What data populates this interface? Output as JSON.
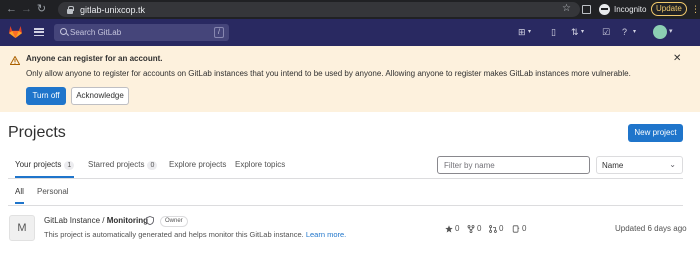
{
  "browser": {
    "url": "gitlab-unixcop.tk",
    "incognito_label": "Incognito",
    "update_label": "Update"
  },
  "search": {
    "placeholder": "Search GitLab",
    "shortcut": "/"
  },
  "alert": {
    "title": "Anyone can register for an account.",
    "message": "Only allow anyone to register for accounts on GitLab instances that you intend to be used by anyone. Allowing anyone to register makes GitLab instances more vulnerable.",
    "primary_button": "Turn off",
    "secondary_button": "Acknowledge"
  },
  "page": {
    "title": "Projects",
    "new_project_button": "New project"
  },
  "tabs": [
    {
      "label": "Your projects",
      "count": "1"
    },
    {
      "label": "Starred projects",
      "count": "0"
    },
    {
      "label": "Explore projects"
    },
    {
      "label": "Explore topics"
    }
  ],
  "filter": {
    "placeholder": "Filter by name"
  },
  "sort": {
    "selected": "Name"
  },
  "subtabs": [
    {
      "label": "All"
    },
    {
      "label": "Personal"
    }
  ],
  "project": {
    "avatar_letter": "M",
    "namespace": "GitLab Instance / ",
    "name": "Monitoring",
    "role": "Owner",
    "description": "This project is automatically generated and helps monitor this GitLab instance.",
    "learn_more": "Learn more.",
    "stars": "0",
    "forks": "0",
    "merge_requests": "0",
    "issues": "0",
    "updated": "Updated 6 days ago"
  },
  "colors": {
    "nav_bg": "#292961",
    "alert_bg": "#fdf1dd",
    "primary": "#1f75cb"
  }
}
